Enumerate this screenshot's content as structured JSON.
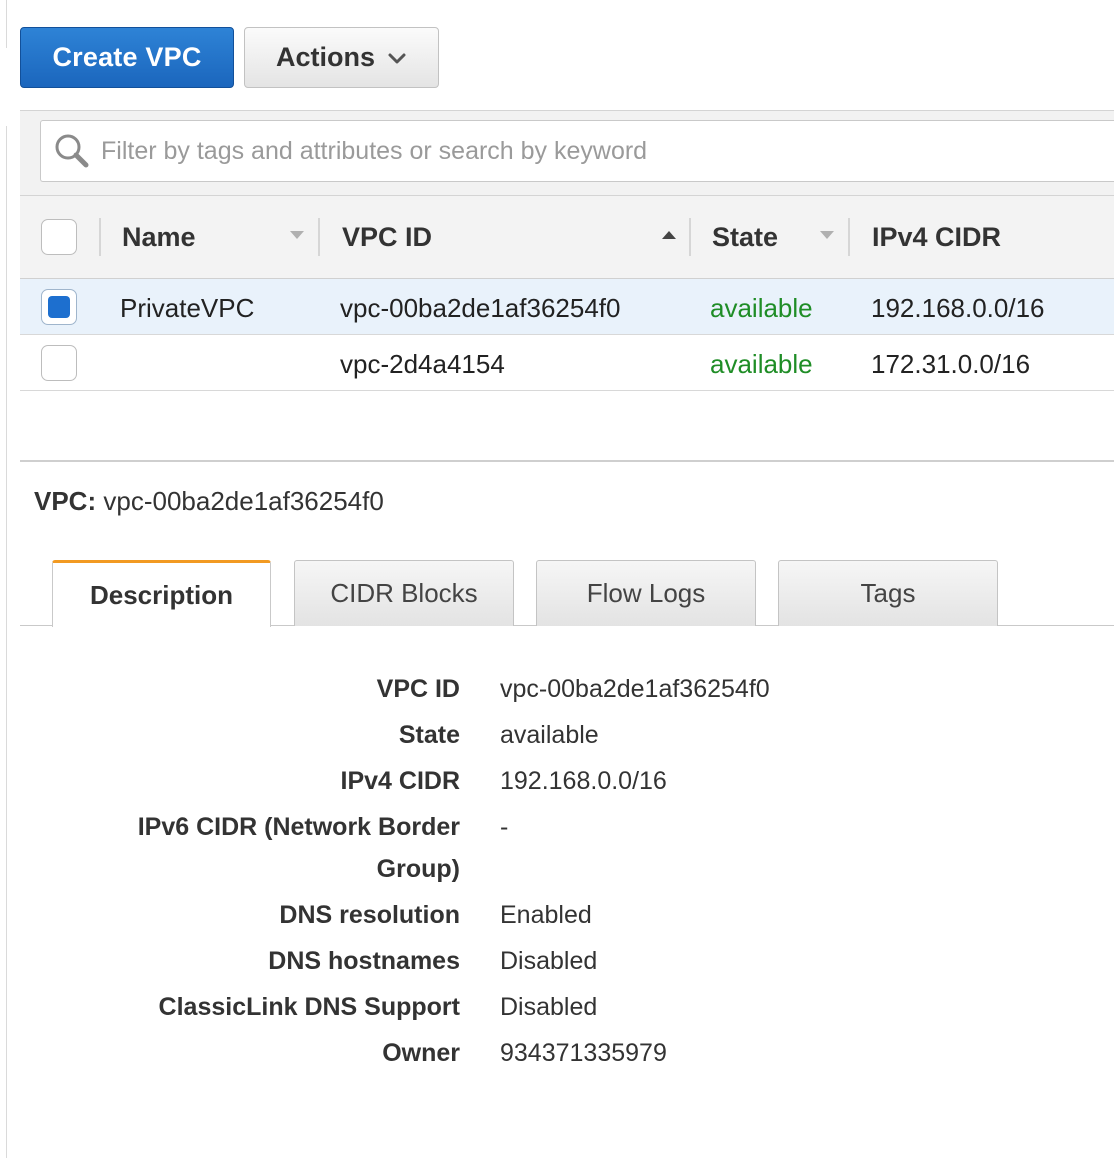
{
  "toolbar": {
    "create_label": "Create VPC",
    "actions_label": "Actions"
  },
  "filter": {
    "placeholder": "Filter by tags and attributes or search by keyword"
  },
  "table": {
    "columns": [
      "Name",
      "VPC ID",
      "State",
      "IPv4 CIDR"
    ],
    "rows": [
      {
        "selected": true,
        "name": "PrivateVPC",
        "vpc_id": "vpc-00ba2de1af36254f0",
        "state": "available",
        "cidr": "192.168.0.0/16"
      },
      {
        "selected": false,
        "name": "",
        "vpc_id": "vpc-2d4a4154",
        "state": "available",
        "cidr": "172.31.0.0/16"
      }
    ]
  },
  "details": {
    "title_label": "VPC:",
    "title_value": "vpc-00ba2de1af36254f0",
    "tabs": [
      "Description",
      "CIDR Blocks",
      "Flow Logs",
      "Tags"
    ],
    "active_tab": "Description",
    "fields": [
      {
        "label": "VPC ID",
        "value": "vpc-00ba2de1af36254f0"
      },
      {
        "label": "State",
        "value": "available"
      },
      {
        "label": "IPv4 CIDR",
        "value": "192.168.0.0/16"
      },
      {
        "label": "IPv6 CIDR (Network Border",
        "label_line2": "Group)",
        "value": "-"
      },
      {
        "label": "DNS resolution",
        "value": "Enabled"
      },
      {
        "label": "DNS hostnames",
        "value": "Disabled"
      },
      {
        "label": "ClassicLink DNS Support",
        "value": "Disabled"
      },
      {
        "label": "Owner",
        "value": "934371335979"
      }
    ]
  },
  "colors": {
    "primary": "#1b66bd",
    "available": "#1f8d26",
    "tab_accent": "#f29a22",
    "selected_row": "#e9f2fb"
  }
}
